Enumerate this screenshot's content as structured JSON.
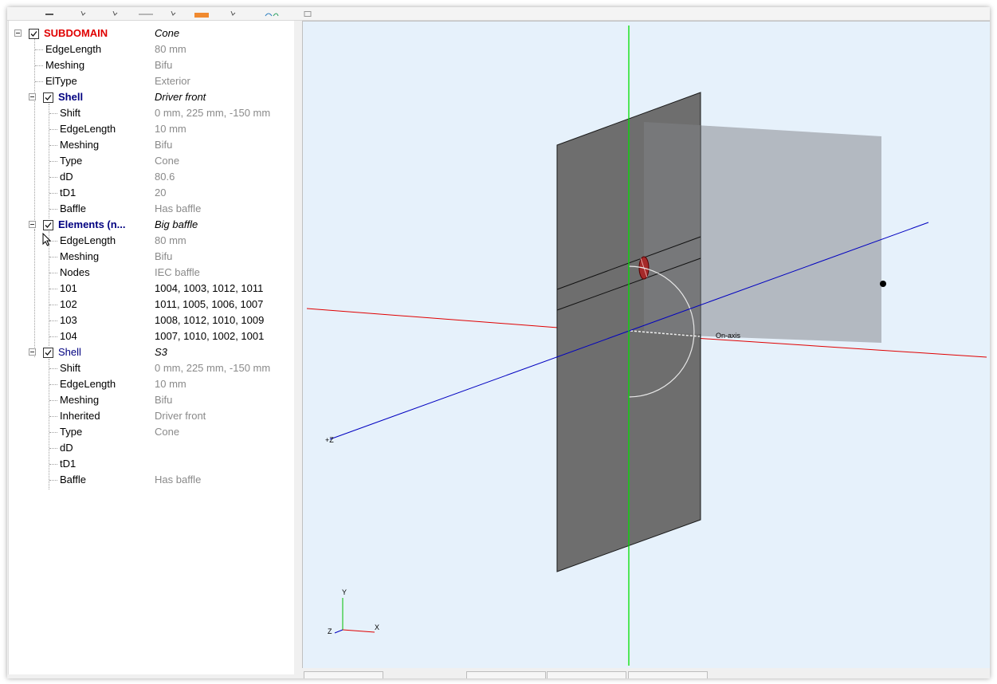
{
  "colors": {
    "viewport_bg": "#e6f1fb",
    "subdomain": "#e00000",
    "navy": "#000080",
    "muted": "#8a8a8a",
    "axis_x": "#e00000",
    "axis_y": "#00e000",
    "axis_z": "#0000c0",
    "baffle_front": "#6e6e6e",
    "baffle_back": "#b3b9c1"
  },
  "tree": {
    "subdomain": {
      "label": "SUBDOMAIN",
      "value": "Cone"
    },
    "subdomain_props": [
      {
        "label": "EdgeLength",
        "value": "80 mm"
      },
      {
        "label": "Meshing",
        "value": "Bifu"
      },
      {
        "label": "ElType",
        "value": "Exterior"
      }
    ],
    "shell1": {
      "label": "Shell",
      "value": "Driver front"
    },
    "shell1_props": [
      {
        "label": "Shift",
        "value": "0 mm, 225 mm, -150 mm"
      },
      {
        "label": "EdgeLength",
        "value": "10 mm"
      },
      {
        "label": "Meshing",
        "value": "Bifu"
      },
      {
        "label": "Type",
        "value": "Cone"
      },
      {
        "label": "dD",
        "value": "80.6"
      },
      {
        "label": "tD1",
        "value": "20"
      },
      {
        "label": "Baffle",
        "value": "Has baffle"
      }
    ],
    "elements": {
      "label": "Elements (n...",
      "value": "Big baffle"
    },
    "elements_props": [
      {
        "label": "EdgeLength",
        "value": "80 mm"
      },
      {
        "label": "Meshing",
        "value": "Bifu"
      },
      {
        "label": "Nodes",
        "value": "IEC baffle"
      },
      {
        "label": "101",
        "value": "1004, 1003, 1012, 1011"
      },
      {
        "label": "102",
        "value": "1011, 1005, 1006, 1007"
      },
      {
        "label": "103",
        "value": "1008, 1012, 1010, 1009"
      },
      {
        "label": "104",
        "value": "1007, 1010, 1002, 1001"
      }
    ],
    "shell2": {
      "label": "Shell",
      "value": "S3"
    },
    "shell2_props": [
      {
        "label": "Shift",
        "value": "0 mm, 225 mm, -150 mm"
      },
      {
        "label": "EdgeLength",
        "value": "10 mm"
      },
      {
        "label": "Meshing",
        "value": "Bifu"
      },
      {
        "label": "Inherited",
        "value": "Driver front"
      },
      {
        "label": "Type",
        "value": "Cone"
      },
      {
        "label": "dD",
        "value": ""
      },
      {
        "label": "tD1",
        "value": ""
      },
      {
        "label": "Baffle",
        "value": "Has baffle"
      }
    ]
  },
  "viewport": {
    "on_axis_label": "On-axis",
    "z_axis_label": "+Z",
    "triad": {
      "x": "X",
      "y": "Y",
      "z": "Z"
    }
  }
}
